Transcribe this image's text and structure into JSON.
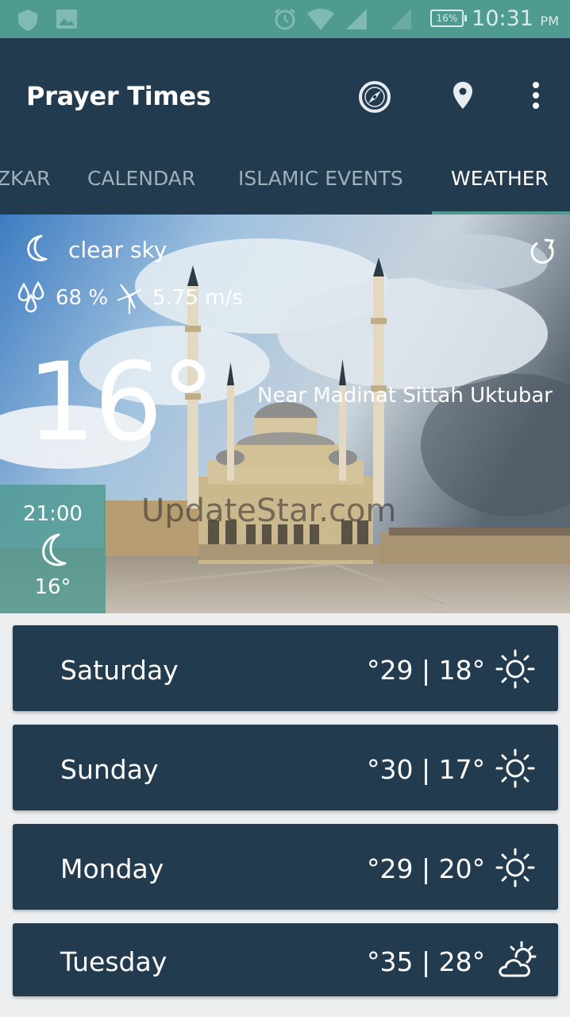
{
  "status_bar": {
    "battery": "16%",
    "time": "10:31",
    "ampm": "PM",
    "icons": [
      "shield-icon",
      "image-icon",
      "alarm-icon",
      "wifi-icon",
      "signal-1-icon",
      "signal-2-icon",
      "battery-icon"
    ]
  },
  "app_bar": {
    "title": "Prayer Times",
    "actions": [
      "compass-icon",
      "location-pin-icon",
      "more-vert-icon"
    ]
  },
  "tabs": [
    {
      "label": "ZKAR",
      "active": false
    },
    {
      "label": "CALENDAR",
      "active": false
    },
    {
      "label": "ISLAMIC EVENTS",
      "active": false
    },
    {
      "label": "WEATHER",
      "active": true
    }
  ],
  "weather": {
    "condition": "clear sky",
    "humidity": "68 %",
    "wind": "5.75 m/s",
    "temperature": "16°",
    "location": "Near Madinat Sittah Uktubar",
    "watermark": "UpdateStar.com",
    "hourly": {
      "time": "21:00",
      "temp": "16°"
    }
  },
  "forecast": [
    {
      "day": "Saturday",
      "temps": "°29 | 18°",
      "icon": "sun-icon"
    },
    {
      "day": "Sunday",
      "temps": "°30 | 17°",
      "icon": "sun-icon"
    },
    {
      "day": "Monday",
      "temps": "°29 | 20°",
      "icon": "sun-icon"
    },
    {
      "day": "Tuesday",
      "temps": "°35 | 28°",
      "icon": "partly-cloudy-icon"
    }
  ],
  "colors": {
    "primary": "#233b4e",
    "accent": "#4f9a91",
    "tab_inactive": "#9fb0bd"
  }
}
